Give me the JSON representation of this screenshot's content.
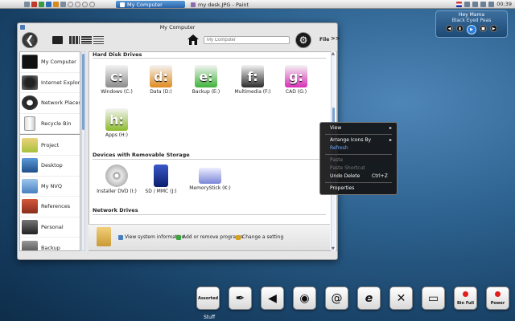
{
  "taskbar": {
    "tasks": [
      {
        "label": "My Computer",
        "active": true
      },
      {
        "label": "my desk.JPG - Paint",
        "active": false
      }
    ],
    "clock": "00:39"
  },
  "music_widget": {
    "artist": "Hey Mama",
    "song": "Black Eyed Peas"
  },
  "window": {
    "title": "My Computer",
    "address_placeholder": "My Computer",
    "file_label": "File",
    "more_label": ">>",
    "back_glyph": "❮"
  },
  "sidebar": {
    "items": [
      {
        "label": "My Computer",
        "icon": "monitor-icon"
      },
      {
        "label": "Internet Explorer",
        "icon": "world-map-icon"
      },
      {
        "label": "Network Places",
        "icon": "network-icon"
      },
      {
        "label": "Recycle Bin",
        "icon": "recycle-bin-icon"
      },
      {
        "label": "Project",
        "icon": "project-folder-icon"
      },
      {
        "label": "Desktop",
        "icon": "desktop-icon"
      },
      {
        "label": "My NVQ",
        "icon": "nvq-folder-icon"
      },
      {
        "label": "References",
        "icon": "references-folder-icon"
      },
      {
        "label": "Personal",
        "icon": "personal-folder-icon"
      },
      {
        "label": "Backup",
        "icon": "backup-folder-icon"
      }
    ]
  },
  "content": {
    "sections": [
      {
        "title": "Hard Disk Drives"
      },
      {
        "title": "Devices with Removable Storage"
      },
      {
        "title": "Network Drives"
      }
    ],
    "hard_drives": [
      {
        "letter": "c:",
        "label": "Windows (C:)",
        "color": "#2e6fc4"
      },
      {
        "letter": "d:",
        "label": "Data (D:)",
        "color": "#e08a1e"
      },
      {
        "letter": "e:",
        "label": "Backup (E:)",
        "color": "#3fb33a"
      },
      {
        "letter": "f:",
        "label": "Multimedia (F:)",
        "color": "#2b2b2b"
      },
      {
        "letter": "g:",
        "label": "CAD (G:)",
        "color": "#d82fb6"
      },
      {
        "letter": "h:",
        "label": "Apps (H:)",
        "color": "#8dbb2e"
      }
    ],
    "removable": [
      {
        "label": "Installer DVD (I:)",
        "icon": "dvd-icon"
      },
      {
        "label": "SD / MMC (J:)",
        "icon": "sd-card-icon"
      },
      {
        "label": "MemoryStick (K:)",
        "icon": "memorystick-icon"
      }
    ],
    "tasks": [
      {
        "label": "View system information"
      },
      {
        "label": "Add or remove programs"
      },
      {
        "label": "Change a setting"
      }
    ]
  },
  "context_menu": {
    "items": [
      {
        "label": "View",
        "submenu": true,
        "disabled": false
      },
      {
        "label": "Arrange Icons By",
        "submenu": true,
        "disabled": false
      },
      {
        "label": "Refresh",
        "submenu": false,
        "disabled": false,
        "highlight": true
      },
      {
        "label": "Paste",
        "submenu": false,
        "disabled": true
      },
      {
        "label": "Paste Shortcut",
        "submenu": false,
        "disabled": true
      },
      {
        "label": "Undo Delete",
        "submenu": false,
        "disabled": false,
        "shortcut": "Ctrl+Z"
      },
      {
        "label": "Properties",
        "submenu": false,
        "disabled": false
      }
    ]
  },
  "dock": {
    "items": [
      {
        "name": "assorted",
        "label": "Assorted"
      },
      {
        "name": "pen",
        "glyph": "✒"
      },
      {
        "name": "speaker",
        "glyph": "◀"
      },
      {
        "name": "firefox",
        "glyph": "◉"
      },
      {
        "name": "email",
        "glyph": "@"
      },
      {
        "name": "ie",
        "glyph": "e"
      },
      {
        "name": "tools",
        "glyph": "✕"
      },
      {
        "name": "computer",
        "glyph": "▭"
      },
      {
        "name": "bin-full",
        "label": "Bin Full"
      },
      {
        "name": "power",
        "label": "Power"
      }
    ],
    "caption": "Stuff"
  }
}
